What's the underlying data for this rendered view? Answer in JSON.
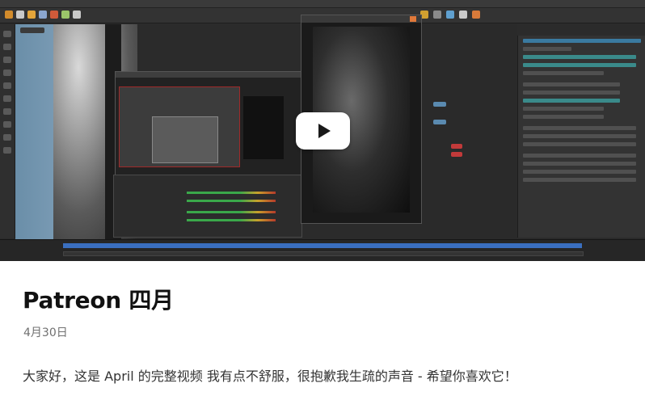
{
  "post": {
    "title": "Patreon 四月",
    "date": "4月30日",
    "body": "大家好，这是 April 的完整视频 我有点不舒服，很抱歉我生疏的声音 - 希望你喜欢它！"
  },
  "video": {
    "play_icon": "play-icon"
  }
}
